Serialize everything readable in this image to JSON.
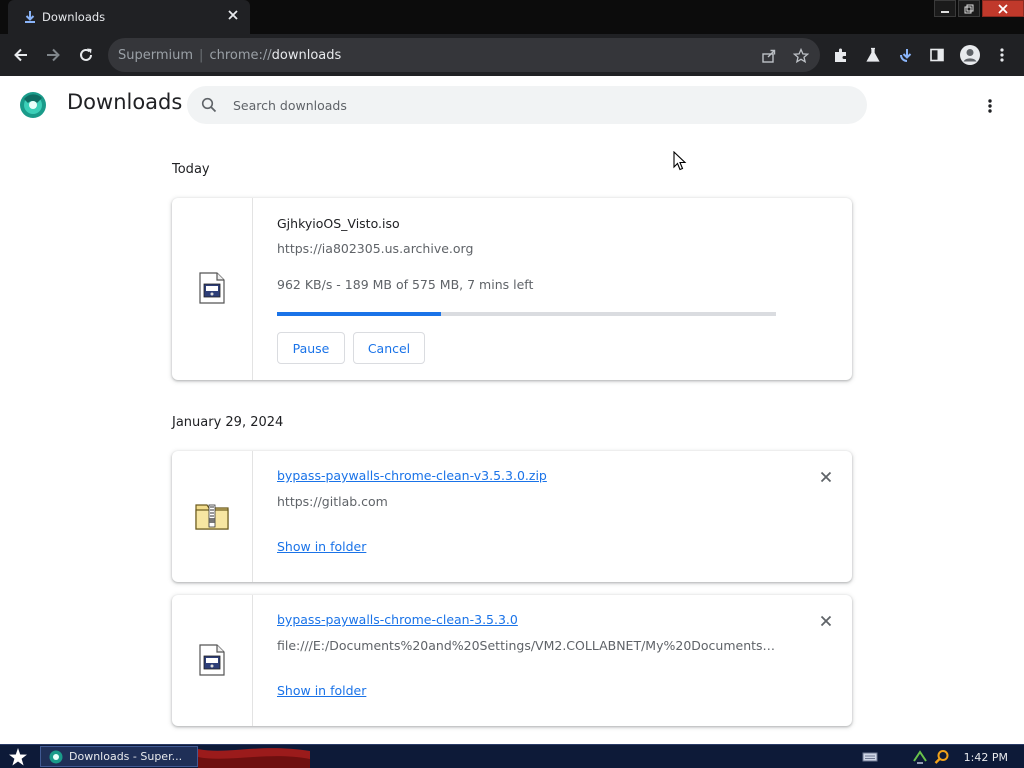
{
  "browser": {
    "tab_title": "Downloads",
    "omnibox": {
      "app": "Supermium",
      "scheme": "chrome://",
      "path": "downloads"
    }
  },
  "page": {
    "title": "Downloads",
    "search_placeholder": "Search downloads"
  },
  "groups": [
    {
      "date": "Today",
      "items": [
        {
          "file_name": "GjhkyioOS_Visto.iso",
          "source": "https://ia802305.us.archive.org",
          "status": "962 KB/s - 189 MB of 575 MB, 7 mins left",
          "progress_fraction": 0.3287,
          "pause_label": "Pause",
          "cancel_label": "Cancel",
          "icon": "disc-image-file-icon"
        }
      ]
    },
    {
      "date": "January 29, 2024",
      "items": [
        {
          "file_name": "bypass-paywalls-chrome-clean-v3.5.3.0.zip",
          "source": "https://gitlab.com",
          "action_label": "Show in folder",
          "icon": "zip-folder-icon"
        },
        {
          "file_name": "bypass-paywalls-chrome-clean-3.5.3.0",
          "source": "file:///E:/Documents%20and%20Settings/VM2.COLLABNET/My%20Documents/Down...",
          "action_label": "Show in folder",
          "icon": "generic-file-icon"
        }
      ]
    }
  ],
  "taskbar": {
    "task_label": "Downloads - Super...",
    "clock": "1:42 PM"
  },
  "colors": {
    "accent": "#1a73e8",
    "toolbar": "#202124",
    "tabstrip": "#0c0c0c",
    "taskbar": "#0d1a38"
  }
}
